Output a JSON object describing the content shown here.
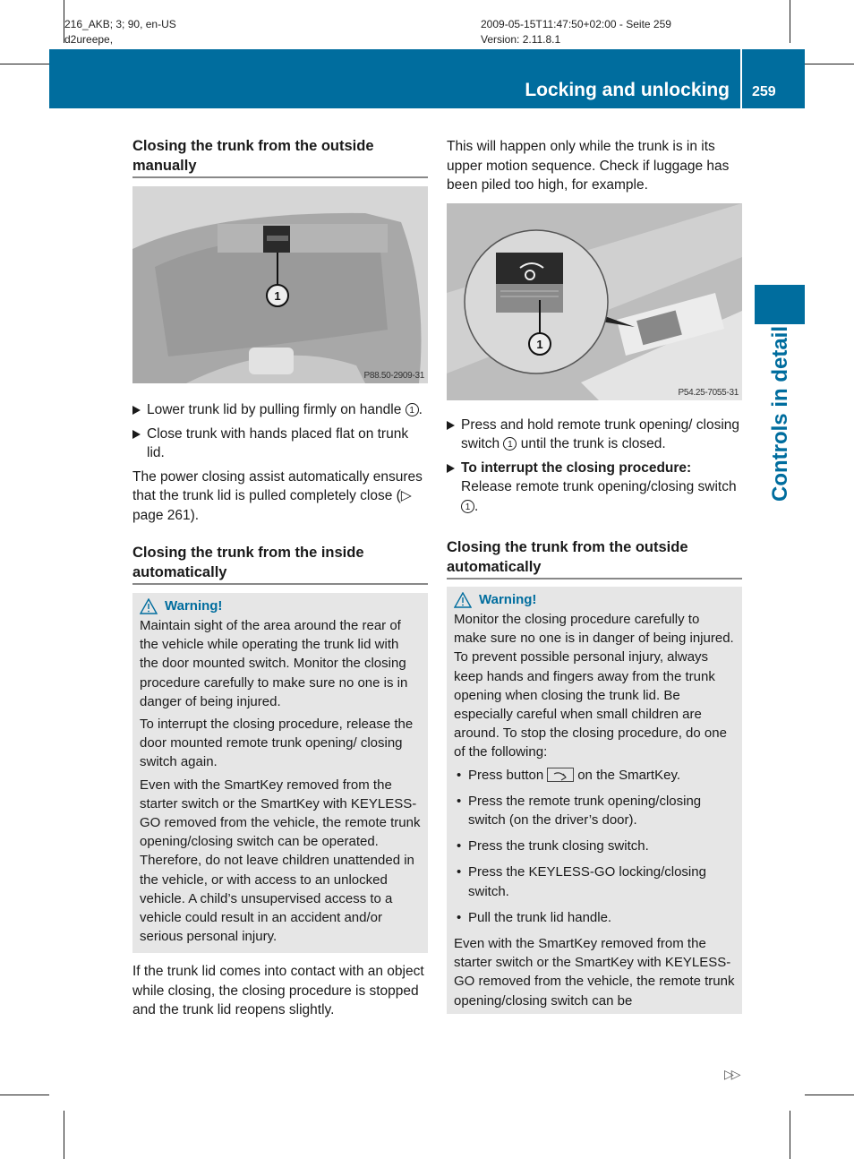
{
  "meta": {
    "left_line1": "216_AKB; 3; 90, en-US",
    "left_line2": "d2ureepe,",
    "right_line1": "2009-05-15T11:47:50+02:00 - Seite 259",
    "right_line2": "Version: 2.11.8.1"
  },
  "header": {
    "section_title": "Locking and unlocking",
    "page_number": "259",
    "side_label": "Controls in detail",
    "brand_color": "#006d9e"
  },
  "left": {
    "heading1": "Closing the trunk from the outside manually",
    "figure1": {
      "id": "P88.50-2909-31",
      "callout": "1"
    },
    "steps": [
      {
        "text": "Lower trunk lid by pulling firmly on handle",
        "ref": "1",
        "suffix": "."
      },
      {
        "text": "Close trunk with hands placed flat on trunk lid."
      }
    ],
    "para1": "The power closing assist automatically ensures that the trunk lid is pulled completely close (▷ page 261).",
    "heading2": "Closing the trunk from the inside automatically",
    "warning": {
      "title": "Warning!",
      "paragraphs": [
        "Maintain sight of the area around the rear of the vehicle while operating the trunk lid with the door mounted switch. Monitor the closing procedure carefully to make sure no one is in danger of being injured.",
        "To interrupt the closing procedure, release the door mounted remote trunk opening/ closing switch again.",
        "Even with the SmartKey removed from the starter switch or the SmartKey with KEYLESS-GO removed from the vehicle, the remote trunk opening/closing switch can be operated. Therefore, do not leave children unattended in the vehicle, or with access to an unlocked vehicle. A child’s unsupervised access to a vehicle could result in an accident and/or serious personal injury."
      ]
    },
    "para2": "If the trunk lid comes into contact with an object while closing, the closing procedure is stopped and the trunk lid reopens slightly."
  },
  "right": {
    "para1": "This will happen only while the trunk is in its upper motion sequence. Check if luggage has been piled too high, for example.",
    "figure2": {
      "id": "P54.25-7055-31",
      "callout": "1"
    },
    "steps": [
      {
        "prefix": "Press and hold remote trunk opening/ closing switch",
        "ref": "1",
        "suffix": "until the trunk is closed."
      },
      {
        "bold": "To interrupt the closing procedure:",
        "text": "Release remote trunk opening/closing switch",
        "ref": "1",
        "suffix": "."
      }
    ],
    "heading": "Closing the trunk from the outside automatically",
    "warning": {
      "title": "Warning!",
      "intro": "Monitor the closing procedure carefully to make sure no one is in danger of being injured. To prevent possible personal injury, always keep hands and fingers away from the trunk opening when closing the trunk lid. Be especially careful when small children are around. To stop the closing procedure, do one of the following:",
      "bullets": [
        {
          "before": "Press button",
          "after": "on the SmartKey."
        },
        {
          "text": "Press the remote trunk opening/closing switch (on the driver’s door)."
        },
        {
          "text": "Press the trunk closing switch."
        },
        {
          "text": "Press the KEYLESS-GO locking/closing switch."
        },
        {
          "text": "Pull the trunk lid handle."
        }
      ],
      "outro": "Even with the SmartKey removed from the starter switch or the SmartKey with KEYLESS-GO removed from the vehicle, the remote trunk opening/closing switch can be"
    }
  },
  "footer": {
    "continue_marker": "▷▷"
  }
}
